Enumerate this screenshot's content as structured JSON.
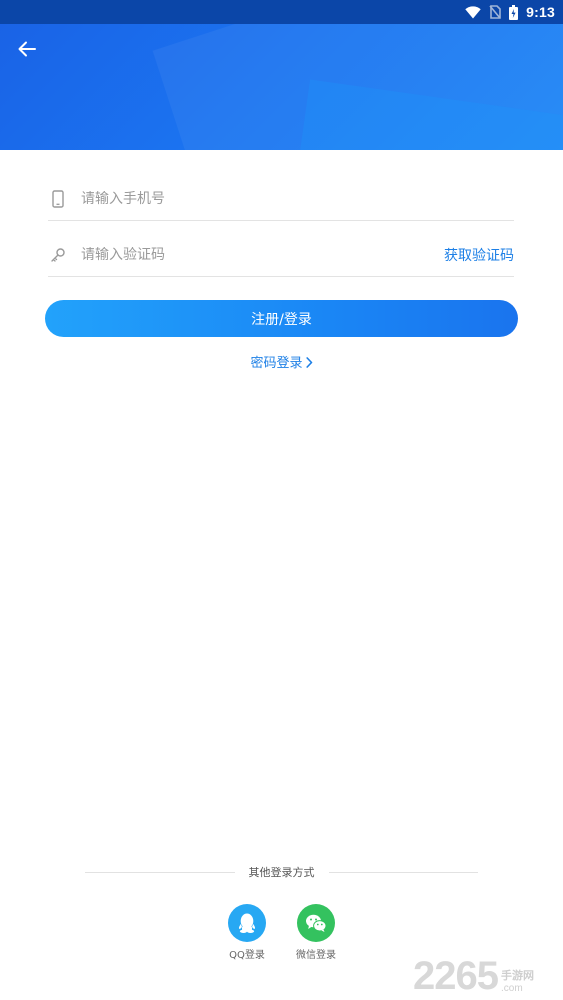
{
  "status_bar": {
    "time": "9:13",
    "icons": [
      "wifi-icon",
      "no-sim-icon",
      "battery-charging-icon"
    ],
    "background_color": "#0b46a8"
  },
  "header": {
    "back_icon": "arrow-left-icon",
    "gradient_colors": [
      "#1a63e6",
      "#1d86f6"
    ]
  },
  "form": {
    "phone": {
      "icon": "phone-icon",
      "placeholder": "请输入手机号",
      "value": ""
    },
    "code": {
      "icon": "key-icon",
      "placeholder": "请输入验证码",
      "value": "",
      "get_code_label": "获取验证码"
    }
  },
  "submit_label": "注册/登录",
  "password_login_label": "密码登录",
  "other_login": {
    "title": "其他登录方式",
    "options": [
      {
        "label": "QQ登录",
        "icon": "qq-icon",
        "color": "#27a8f3"
      },
      {
        "label": "微信登录",
        "icon": "wechat-icon",
        "color": "#34c25f"
      }
    ]
  },
  "watermark": {
    "number": "2265",
    "cn": "手游网",
    "suffix": ".com"
  },
  "accent_color": "#1c7fe6"
}
